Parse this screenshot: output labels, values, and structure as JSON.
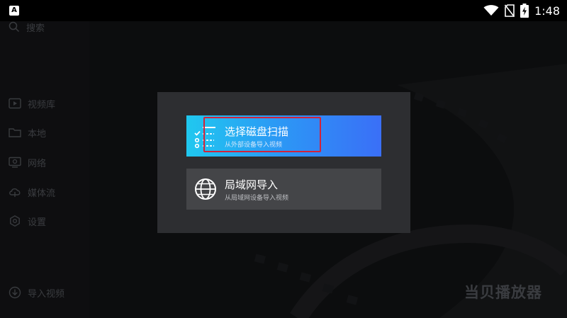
{
  "status_bar": {
    "app_badge": "A",
    "time": "1:48"
  },
  "sidebar": {
    "search_label": "搜索",
    "items": [
      {
        "label": "视频库",
        "icon": "video-library-icon"
      },
      {
        "label": "本地",
        "icon": "folder-icon"
      },
      {
        "label": "网络",
        "icon": "network-icon"
      },
      {
        "label": "媒体流",
        "icon": "stream-icon"
      },
      {
        "label": "设置",
        "icon": "settings-icon"
      }
    ],
    "import_label": "导入视频"
  },
  "watermark": "当贝播放器",
  "dialog": {
    "options": [
      {
        "title": "选择磁盘扫描",
        "subtitle": "从外部设备导入视频",
        "icon": "checklist-icon",
        "focused": true
      },
      {
        "title": "局域网导入",
        "subtitle": "从局域网设备导入视频",
        "icon": "globe-icon",
        "focused": false
      }
    ]
  },
  "colors": {
    "scan_gradient_start": "#20c8ef",
    "scan_gradient_end": "#3a6ff7",
    "focus_border": "#d2233a",
    "dialog_bg": "#2d2e31",
    "lan_option_bg": "#444548"
  }
}
